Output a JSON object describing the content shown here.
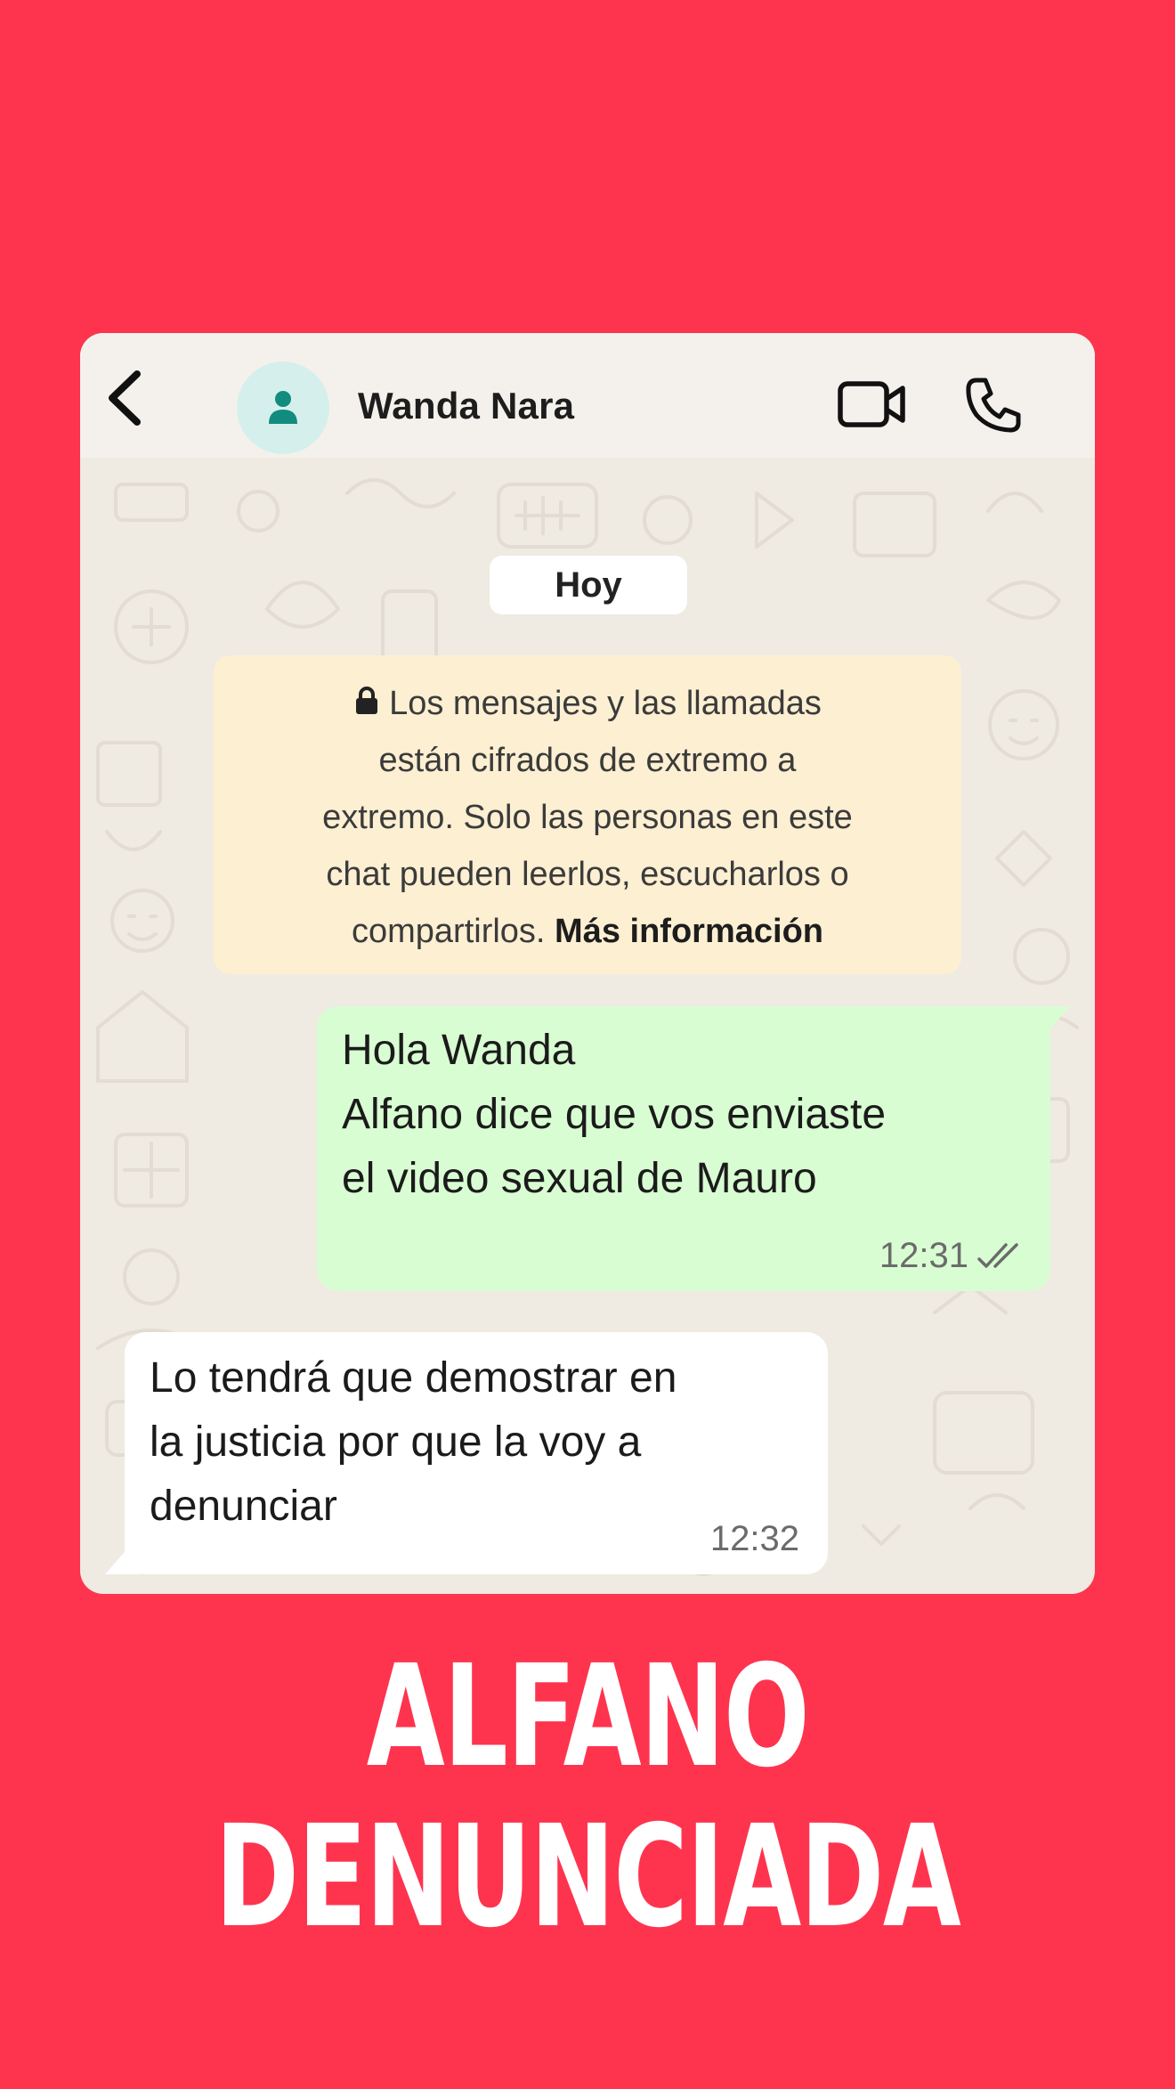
{
  "chat": {
    "contact_name": "Wanda Nara",
    "date_label": "Hoy",
    "encryption_notice": {
      "lines": [
        "Los mensajes y las llamadas",
        "están cifrados de extremo a",
        "extremo. Solo las personas en este",
        "chat pueden leerlos, escucharlos o",
        "compartirlos."
      ],
      "link": "Más información"
    },
    "messages": [
      {
        "direction": "outgoing",
        "lines": [
          "Hola Wanda",
          "Alfano dice que vos enviaste",
          "el video sexual de Mauro"
        ],
        "time": "12:31",
        "status": "read"
      },
      {
        "direction": "incoming",
        "lines": [
          "Lo tendrá que demostrar en",
          "la justicia por que la voy a",
          "denunciar"
        ],
        "time": "12:32"
      }
    ]
  },
  "headline": "ALFANO DENUNCIADA",
  "icons": {
    "back": "chevron-left-icon",
    "avatar": "person-icon",
    "video": "video-camera-icon",
    "call": "phone-icon",
    "lock": "lock-icon",
    "read_receipt": "double-check-icon"
  },
  "colors": {
    "background": "#fe344f",
    "chat_background": "#efeae2",
    "outgoing_bubble": "#d9fdd3",
    "incoming_bubble": "#ffffff",
    "notice_background": "#fdefd2",
    "avatar_accent": "#128c7e"
  }
}
